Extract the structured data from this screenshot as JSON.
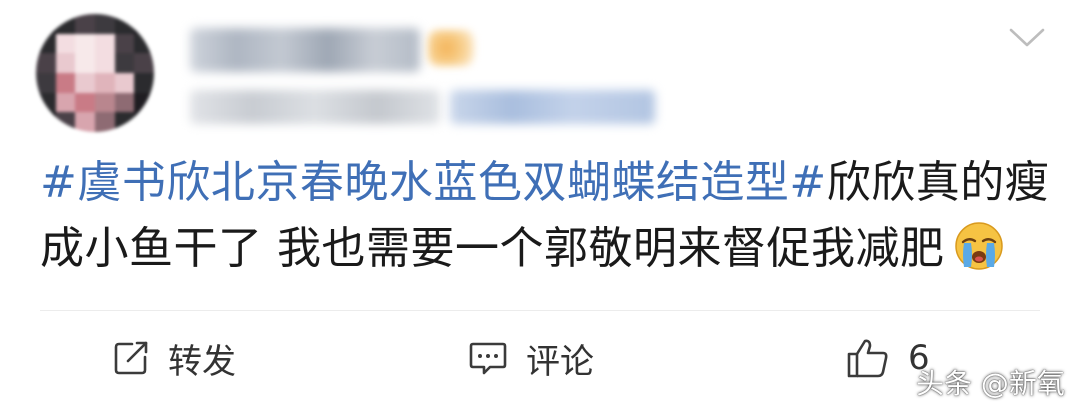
{
  "post": {
    "topic": "#虞书欣北京春晚水蓝色双蝴蝶结造型#",
    "body": "欣欣真的瘦成小鱼干了 我也需要一个郭敬明来督促我减肥",
    "emoji": "crying-face-emoji"
  },
  "actions": {
    "repost_label": "转发",
    "comment_label": "评论",
    "like_count": "6"
  },
  "watermark": {
    "text": "头条 @新氧"
  },
  "icons": {
    "more": "chevron-down-icon",
    "repost": "repost-icon",
    "comment": "comment-icon",
    "like": "thumbs-up-icon"
  },
  "colors": {
    "topic": "#3f6fb6",
    "text": "#1a1a1a",
    "icon": "#3b3b3b",
    "emoji_face": "#f6c343",
    "emoji_tears": "#5aa9e6"
  }
}
